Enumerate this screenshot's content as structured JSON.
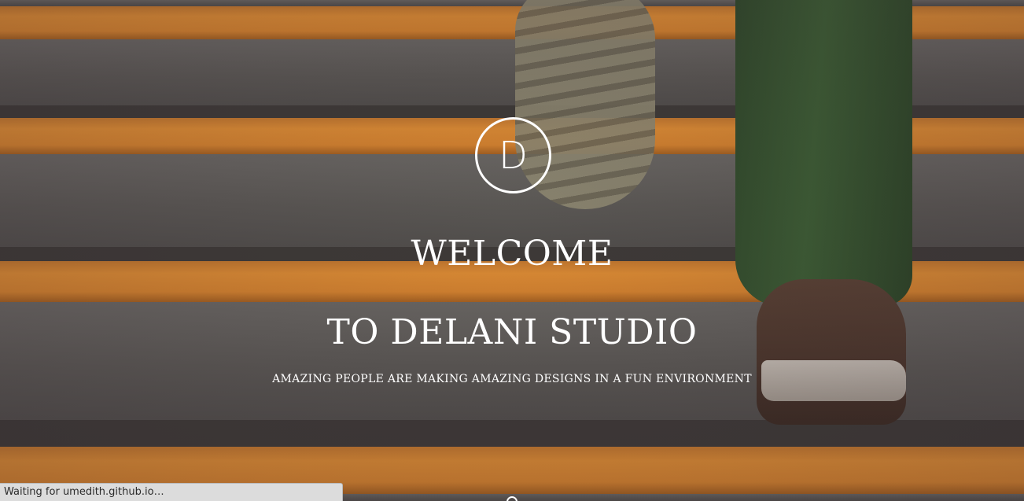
{
  "hero": {
    "logo_letter": "D",
    "headline_line1": "WELCOME",
    "headline_line2": "TO DELANI STUDIO",
    "tagline": "AMAZING PEOPLE ARE MAKING AMAZING DESIGNS IN A FUN ENVIRONMENT"
  },
  "browser": {
    "status_text": "Waiting for umedith.github.io…"
  },
  "colors": {
    "stair_orange": "#e18e33",
    "stair_grey": "#5d5b57",
    "text": "#ffffff"
  },
  "icons": {
    "logo": "circle-letter-logo",
    "scroll": "scroll-down-indicator"
  }
}
